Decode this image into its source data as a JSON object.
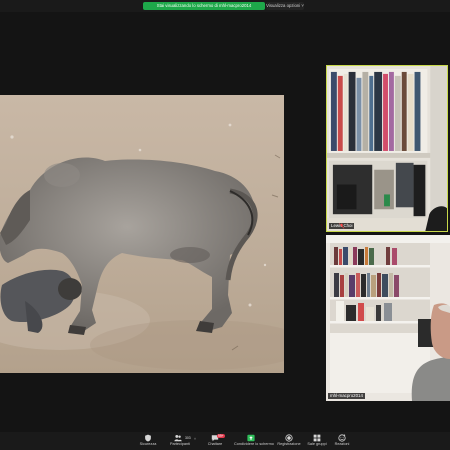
{
  "top_bar": {
    "share_banner": "Stai visualizzando lo schermo di mhl-macpro2014",
    "view_options": "Visualizza opzioni ˅"
  },
  "shared_screen": {
    "owner": "mhl-macpro2014",
    "content": "photo"
  },
  "participants": [
    {
      "name": "Lewis Choi",
      "muted": true,
      "active_speaker": true
    },
    {
      "name": "mhl-macpro2014",
      "muted": false,
      "active_speaker": false
    }
  ],
  "toolbar": {
    "items": [
      {
        "label": "Sicurezza",
        "icon": "shield-icon"
      },
      {
        "label": "Partecipanti",
        "icon": "participants-icon",
        "count": "303"
      },
      {
        "label": "Chattare",
        "icon": "chat-icon",
        "badge": "99+"
      },
      {
        "label": "Condividere lo schermo",
        "icon": "share-screen-icon",
        "active": true
      },
      {
        "label": "Registrazione",
        "icon": "record-icon"
      },
      {
        "label": "Sale gruppi",
        "icon": "breakout-rooms-icon"
      },
      {
        "label": "Reazioni",
        "icon": "reactions-icon"
      }
    ]
  },
  "colors": {
    "banner": "#1ea84a",
    "active_speaker_border": "#c8d94a",
    "share_icon": "#2fbe5a",
    "chat_badge": "#e0364a"
  }
}
